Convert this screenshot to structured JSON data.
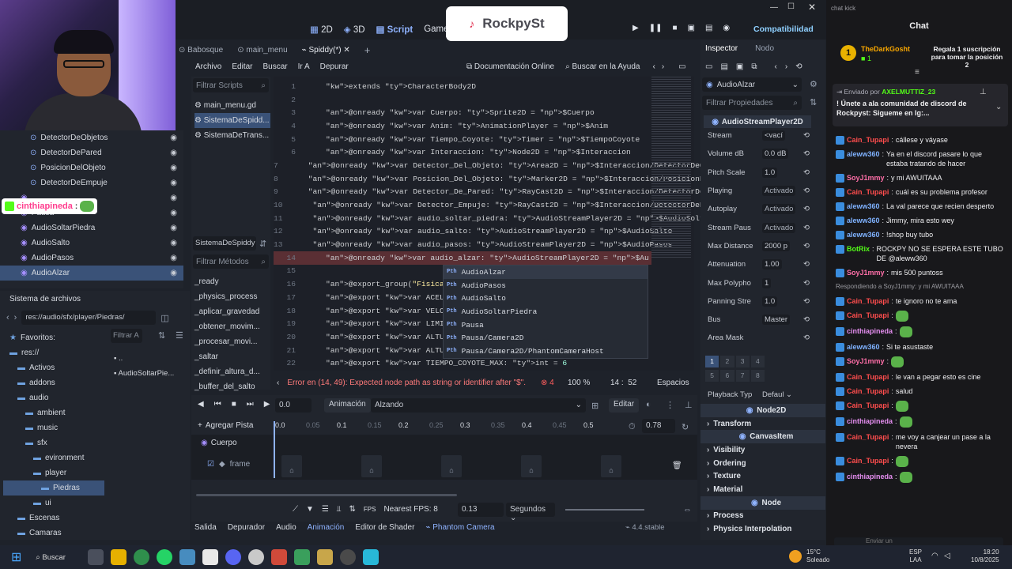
{
  "overlay": {
    "rockpy_label": "RockpySt",
    "webcam_tag": "cinthiapineda",
    "webcam_tag_sep": ":"
  },
  "topbar": {
    "btn_2d": "2D",
    "btn_3d": "3D",
    "btn_script": "Script",
    "btn_game": "Game",
    "renderer": "Compatibilidad"
  },
  "editor_tabs": [
    "Babosque",
    "main_menu",
    "Spiddy(*)"
  ],
  "script_menu": [
    "Archivo",
    "Editar",
    "Buscar",
    "Ir A",
    "Depurar"
  ],
  "doc_online": "Documentación Online",
  "search_help": "Buscar en la Ayuda",
  "scene_tree": {
    "items": [
      {
        "label": "DetectorDeObjetos",
        "indent": 2
      },
      {
        "label": "DetectorDePared",
        "indent": 2
      },
      {
        "label": "PosicionDelObjeto",
        "indent": 2
      },
      {
        "label": "DetectorDeEmpuje",
        "indent": 2
      },
      {
        "label": "",
        "indent": 1
      },
      {
        "label": "Pausa",
        "indent": 1
      },
      {
        "label": "AudioSoltarPiedra",
        "indent": 1
      },
      {
        "label": "AudioSalto",
        "indent": 1
      },
      {
        "label": "AudioPasos",
        "indent": 1
      },
      {
        "label": "AudioAlzar",
        "indent": 1,
        "selected": true
      }
    ]
  },
  "filesystem": {
    "title": "Sistema de archivos",
    "path": "res://audio/sfx/player/Piedras/",
    "filter_placeholder": "Filtrar A",
    "tree": [
      {
        "label": "Favoritos:",
        "indent": 0
      },
      {
        "label": "res://",
        "indent": 0
      },
      {
        "label": "Activos",
        "indent": 1
      },
      {
        "label": "addons",
        "indent": 1
      },
      {
        "label": "audio",
        "indent": 1
      },
      {
        "label": "ambient",
        "indent": 2
      },
      {
        "label": "music",
        "indent": 2
      },
      {
        "label": "sfx",
        "indent": 2
      },
      {
        "label": "evironment",
        "indent": 3
      },
      {
        "label": "player",
        "indent": 3
      },
      {
        "label": "Piedras",
        "indent": 4,
        "selected": true
      },
      {
        "label": "ui",
        "indent": 3
      },
      {
        "label": "Escenas",
        "indent": 1
      },
      {
        "label": "Camaras",
        "indent": 1
      }
    ],
    "files": [
      "..",
      "AudioSoltarPie..."
    ]
  },
  "scripts": {
    "filter_placeholder": "Filtrar Scripts",
    "items": [
      "main_menu.gd",
      "SistemaDeSpidd...",
      "SistemaDeTrans..."
    ],
    "current": "SistemaDeSpiddy",
    "methods_placeholder": "Filtrar Métodos",
    "methods": [
      "_ready",
      "_physics_process",
      "_aplicar_gravedad",
      "_obtener_movim...",
      "_procesar_movi...",
      "_saltar",
      "_definir_altura_d...",
      "_buffer_del_salto"
    ]
  },
  "code": {
    "lines": [
      {
        "n": "1",
        "t": "extends CharacterBody2D"
      },
      {
        "n": "2",
        "t": ""
      },
      {
        "n": "3",
        "t": "@onready var Cuerpo: Sprite2D = $Cuerpo"
      },
      {
        "n": "4",
        "t": "@onready var Anim: AnimationPlayer = $Anim"
      },
      {
        "n": "5",
        "t": "@onready var Tiempo_Coyote: Timer = $TiempoCoyote"
      },
      {
        "n": "6",
        "t": "@onready var Interaccion: Node2D = $Interaccion"
      },
      {
        "n": "7",
        "t": "@onready var Detector_Del_Objeto: Area2D = $Interaccion/DetectorDeObjet"
      },
      {
        "n": "8",
        "t": "@onready var Posicion_Del_Objeto: Marker2D = $Interaccion/PosicionDelOb"
      },
      {
        "n": "9",
        "t": "@onready var Detector_De_Pared: RayCast2D = $Interaccion/DetectorDePare"
      },
      {
        "n": "10",
        "t": "@onready var Detector_Empuje: RayCast2D = $Interaccion/DetectorDeEmpuje"
      },
      {
        "n": "11",
        "t": "@onready var audio_soltar_piedra: AudioStreamPlayer2D = $AudioSoltarPie"
      },
      {
        "n": "12",
        "t": "@onready var audio_salto: AudioStreamPlayer2D = $AudioSalto"
      },
      {
        "n": "13",
        "t": "@onready var audio_pasos: AudioStreamPlayer2D = $AudioPasos"
      },
      {
        "n": "14",
        "t": "@onready var audio_alzar: AudioStreamPlayer2D = $Au"
      },
      {
        "n": "15",
        "t": ""
      },
      {
        "n": "16",
        "t": "@export_group(\"Fisicas\")"
      },
      {
        "n": "17",
        "t": "@export var ACELERACION: "
      },
      {
        "n": "18",
        "t": "@export var VELOCIDAD_MAX"
      },
      {
        "n": "19",
        "t": "@export var LIMITE_DE_VEL"
      },
      {
        "n": "20",
        "t": "@export var ALTURA_DEL_SA"
      },
      {
        "n": "21",
        "t": "@export var ALTURA_MIN_DE"
      },
      {
        "n": "22",
        "t": "@export var TIEMPO_COYOTE_MAX: int = 6"
      }
    ],
    "autocomplete": [
      "AudioAlzar",
      "AudioPasos",
      "AudioSalto",
      "AudioSoltarPiedra",
      "Pausa",
      "Pausa/Camera2D",
      "Pausa/Camera2D/PhantomCameraHost"
    ],
    "error": "Error en (14, 49): Expected node path as string or identifier after \"$\".",
    "error_count": "4",
    "zoom": "100 %",
    "cursor": "14 :  52",
    "indent_mode": "Espacios"
  },
  "animation": {
    "time": "0.0",
    "label": "Animación",
    "current": "Alzando",
    "edit": "Editar",
    "add_track": "Agregar Pista",
    "ticks": [
      "0.0",
      "0.05",
      "0.1",
      "0.15",
      "0.2",
      "0.25",
      "0.3",
      "0.35",
      "0.4",
      "0.45",
      "0.5"
    ],
    "length": "0.78",
    "tracks": [
      "Cuerpo",
      "frame"
    ],
    "nearest_fps": "Nearest FPS: 8",
    "fps_label": "FPS",
    "step": "0.13",
    "unit": "Segundos"
  },
  "bottom_tabs": [
    "Salida",
    "Depurador",
    "Audio",
    "Animación",
    "Editor de Shader",
    "Phantom Camera"
  ],
  "version": "4.4.stable",
  "inspector": {
    "tabs": [
      "Inspector",
      "Nodo"
    ],
    "node": "AudioAlzar",
    "filter_placeholder": "Filtrar Propiedades",
    "class": "AudioStreamPlayer2D",
    "props": [
      {
        "label": "Stream",
        "value": "<vací"
      },
      {
        "label": "Volume dB",
        "value": "0.0  dB"
      },
      {
        "label": "Pitch Scale",
        "value": "1.0"
      },
      {
        "label": "Playing",
        "value": "Activado"
      },
      {
        "label": "Autoplay",
        "value": "Activado"
      },
      {
        "label": "Stream Paus",
        "value": "Activado"
      },
      {
        "label": "Max Distance",
        "value": "2000  p"
      },
      {
        "label": "Attenuation",
        "value": "1.00"
      },
      {
        "label": "Max Polypho",
        "value": "1"
      },
      {
        "label": "Panning Stre",
        "value": "1.0"
      },
      {
        "label": "Bus",
        "value": "Master"
      },
      {
        "label": "Area Mask",
        "value": ""
      }
    ],
    "mask_numbers": [
      "1",
      "2",
      "3",
      "4",
      "5",
      "6",
      "7",
      "8"
    ],
    "playback_type": {
      "label": "Playback Typ",
      "value": "Defaul"
    },
    "sections": [
      "Node2D",
      "Transform",
      "CanvasItem",
      "Visibility",
      "Ordering",
      "Texture",
      "Material",
      "Node",
      "Process",
      "Physics Interpolation"
    ]
  },
  "chat": {
    "tab_label": "chat kick",
    "title": "Chat",
    "gift": {
      "user": "TheDarkGosht",
      "count": "1",
      "text": "Regala 1 suscripción para tomar la posición 2"
    },
    "pinned": {
      "sent_by": "Enviado por",
      "user": "AXELMUTTIZ_23",
      "text": "! Únete a ala comunidad de discord de Rockpyst: Sigueme en Ig:..."
    },
    "messages": [
      {
        "user": "Cain_Tupapi",
        "text": "cállese y váyase",
        "color": "#ff4d4d"
      },
      {
        "user": "aleww360",
        "text": "Ya en el discord pasare lo que estaba tratando de hacer",
        "color": "#7fb2ff"
      },
      {
        "user": "SoyJ1mmy",
        "text": "y mi AWUITAAA",
        "color": "#ff6fa8"
      },
      {
        "user": "Cain_Tupapi",
        "text": "cuál es su problema profesor",
        "color": "#ff4d4d"
      },
      {
        "user": "aleww360",
        "text": "La val parece que recien desperto",
        "color": "#7fb2ff"
      },
      {
        "user": "aleww360",
        "text": "Jimmy, mira esto wey",
        "color": "#7fb2ff"
      },
      {
        "user": "aleww360",
        "text": "!shop buy tubo",
        "color": "#7fb2ff"
      },
      {
        "user": "BotRix",
        "text": "ROCKPY NO SE ESPERA ESTE TUBO DE @aleww360",
        "color": "#53fc18"
      },
      {
        "user": "SoyJ1mmy",
        "text": "mis 500 puntoss",
        "color": "#ff6fa8"
      },
      {
        "user": "",
        "text": "Respondiendo a SoyJ1mmy: y mi AWUITAAA",
        "color": "#9a9aa0"
      },
      {
        "user": "Cain_Tupapi",
        "text": "te ignoro no te ama",
        "color": "#ff4d4d"
      },
      {
        "user": "Cain_Tupapi",
        "text": "",
        "color": "#ff4d4d"
      },
      {
        "user": "cinthiapineda",
        "text": "",
        "color": "#e58ef0"
      },
      {
        "user": "aleww360",
        "text": "Si te asustaste",
        "color": "#7fb2ff"
      },
      {
        "user": "SoyJ1mmy",
        "text": "",
        "color": "#ff6fa8"
      },
      {
        "user": "Cain_Tupapi",
        "text": "le van a pegar esto es cine",
        "color": "#ff4d4d"
      },
      {
        "user": "Cain_Tupapi",
        "text": "salud",
        "color": "#ff4d4d"
      },
      {
        "user": "Cain_Tupapi",
        "text": "",
        "color": "#ff4d4d"
      },
      {
        "user": "cinthiapineda",
        "text": "",
        "color": "#e58ef0"
      },
      {
        "user": "Cain_Tupapi",
        "text": "me voy a canjear un pase a la nevera",
        "color": "#ff4d4d"
      },
      {
        "user": "Cain_Tupapi",
        "text": "",
        "color": "#ff4d4d"
      },
      {
        "user": "cinthiapineda",
        "text": "",
        "color": "#e58ef0"
      }
    ],
    "input_placeholder": "Enviar un"
  },
  "taskbar": {
    "search": "Buscar",
    "weather_temp": "15°C",
    "weather_text": "Soleado",
    "lang": "ESP",
    "lang2": "LAA",
    "time": "18:20",
    "date": "10/8/2025"
  }
}
